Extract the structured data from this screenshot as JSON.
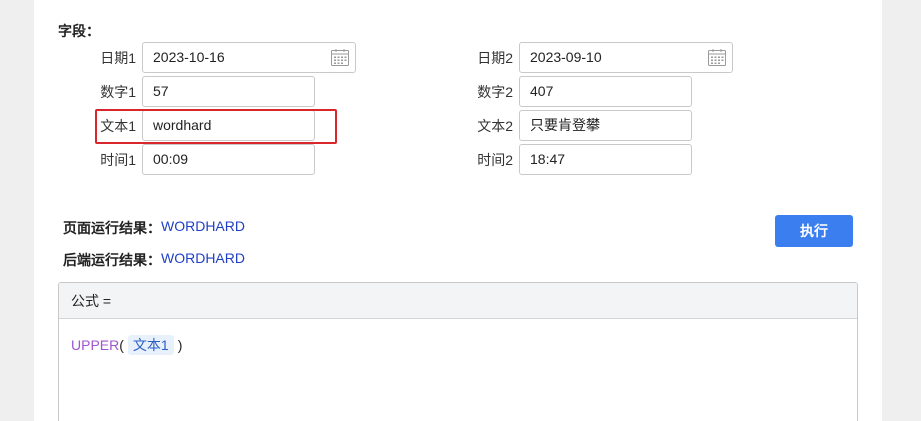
{
  "fields_title": "字段：",
  "left_fields": [
    {
      "label": "日期1",
      "value": "2023-10-16",
      "type": "date"
    },
    {
      "label": "数字1",
      "value": "57",
      "type": "number"
    },
    {
      "label": "文本1",
      "value": "wordhard",
      "type": "text"
    },
    {
      "label": "时间1",
      "value": "00:09",
      "type": "time"
    }
  ],
  "right_fields": [
    {
      "label": "日期2",
      "value": "2023-09-10",
      "type": "date"
    },
    {
      "label": "数字2",
      "value": "407",
      "type": "number"
    },
    {
      "label": "文本2",
      "value": "只要肯登攀",
      "type": "text"
    },
    {
      "label": "时间2",
      "value": "18:47",
      "type": "time"
    }
  ],
  "results": {
    "page_label": "页面运行结果：",
    "page_value": "WORDHARD",
    "backend_label": "后端运行结果：",
    "backend_value": "WORDHARD"
  },
  "execute_button": "执行",
  "formula": {
    "header": "公式 =",
    "function_name": "UPPER",
    "open_paren": "(",
    "argument": "文本1",
    "close_paren": ")"
  },
  "colors": {
    "accent": "#3a7ef0",
    "result_text": "#1f3fc4",
    "highlight": "#d9262b",
    "function": "#a154cf"
  }
}
